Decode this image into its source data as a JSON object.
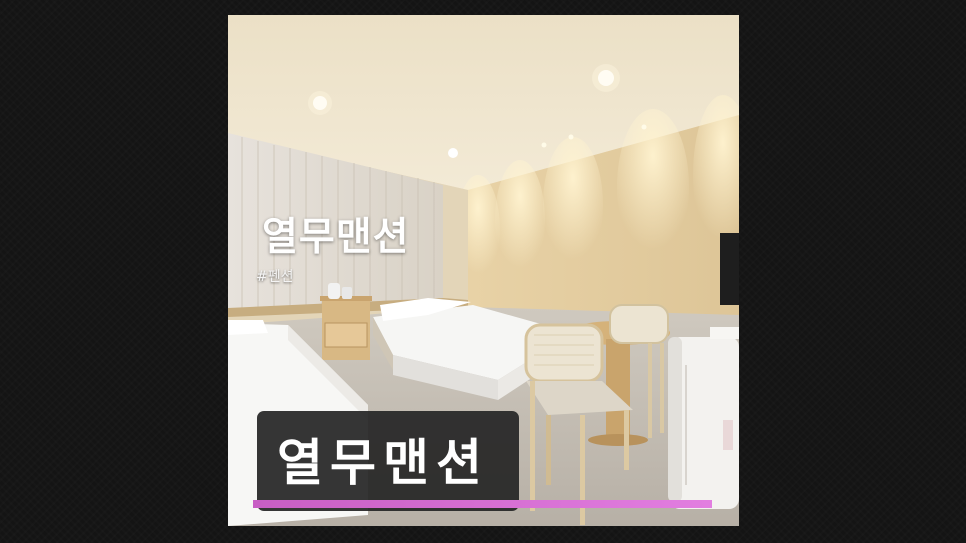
{
  "overlay": {
    "title": "열무맨션",
    "hashtag": "#펜션"
  },
  "caption": {
    "text": "열무맨션"
  },
  "progress": {
    "value": 1.0,
    "color": "#d96bd6"
  },
  "photo": {
    "icons": [
      "ceiling-light-icon",
      "bed-icon",
      "nightstand-icon",
      "kettle-icon",
      "table-icon",
      "chair-icon",
      "tv-icon",
      "refrigerator-icon",
      "curtain-icon"
    ]
  },
  "colors": {
    "background": "#141414",
    "caption_bg": "#262626",
    "wall": "#e8d9b8"
  }
}
